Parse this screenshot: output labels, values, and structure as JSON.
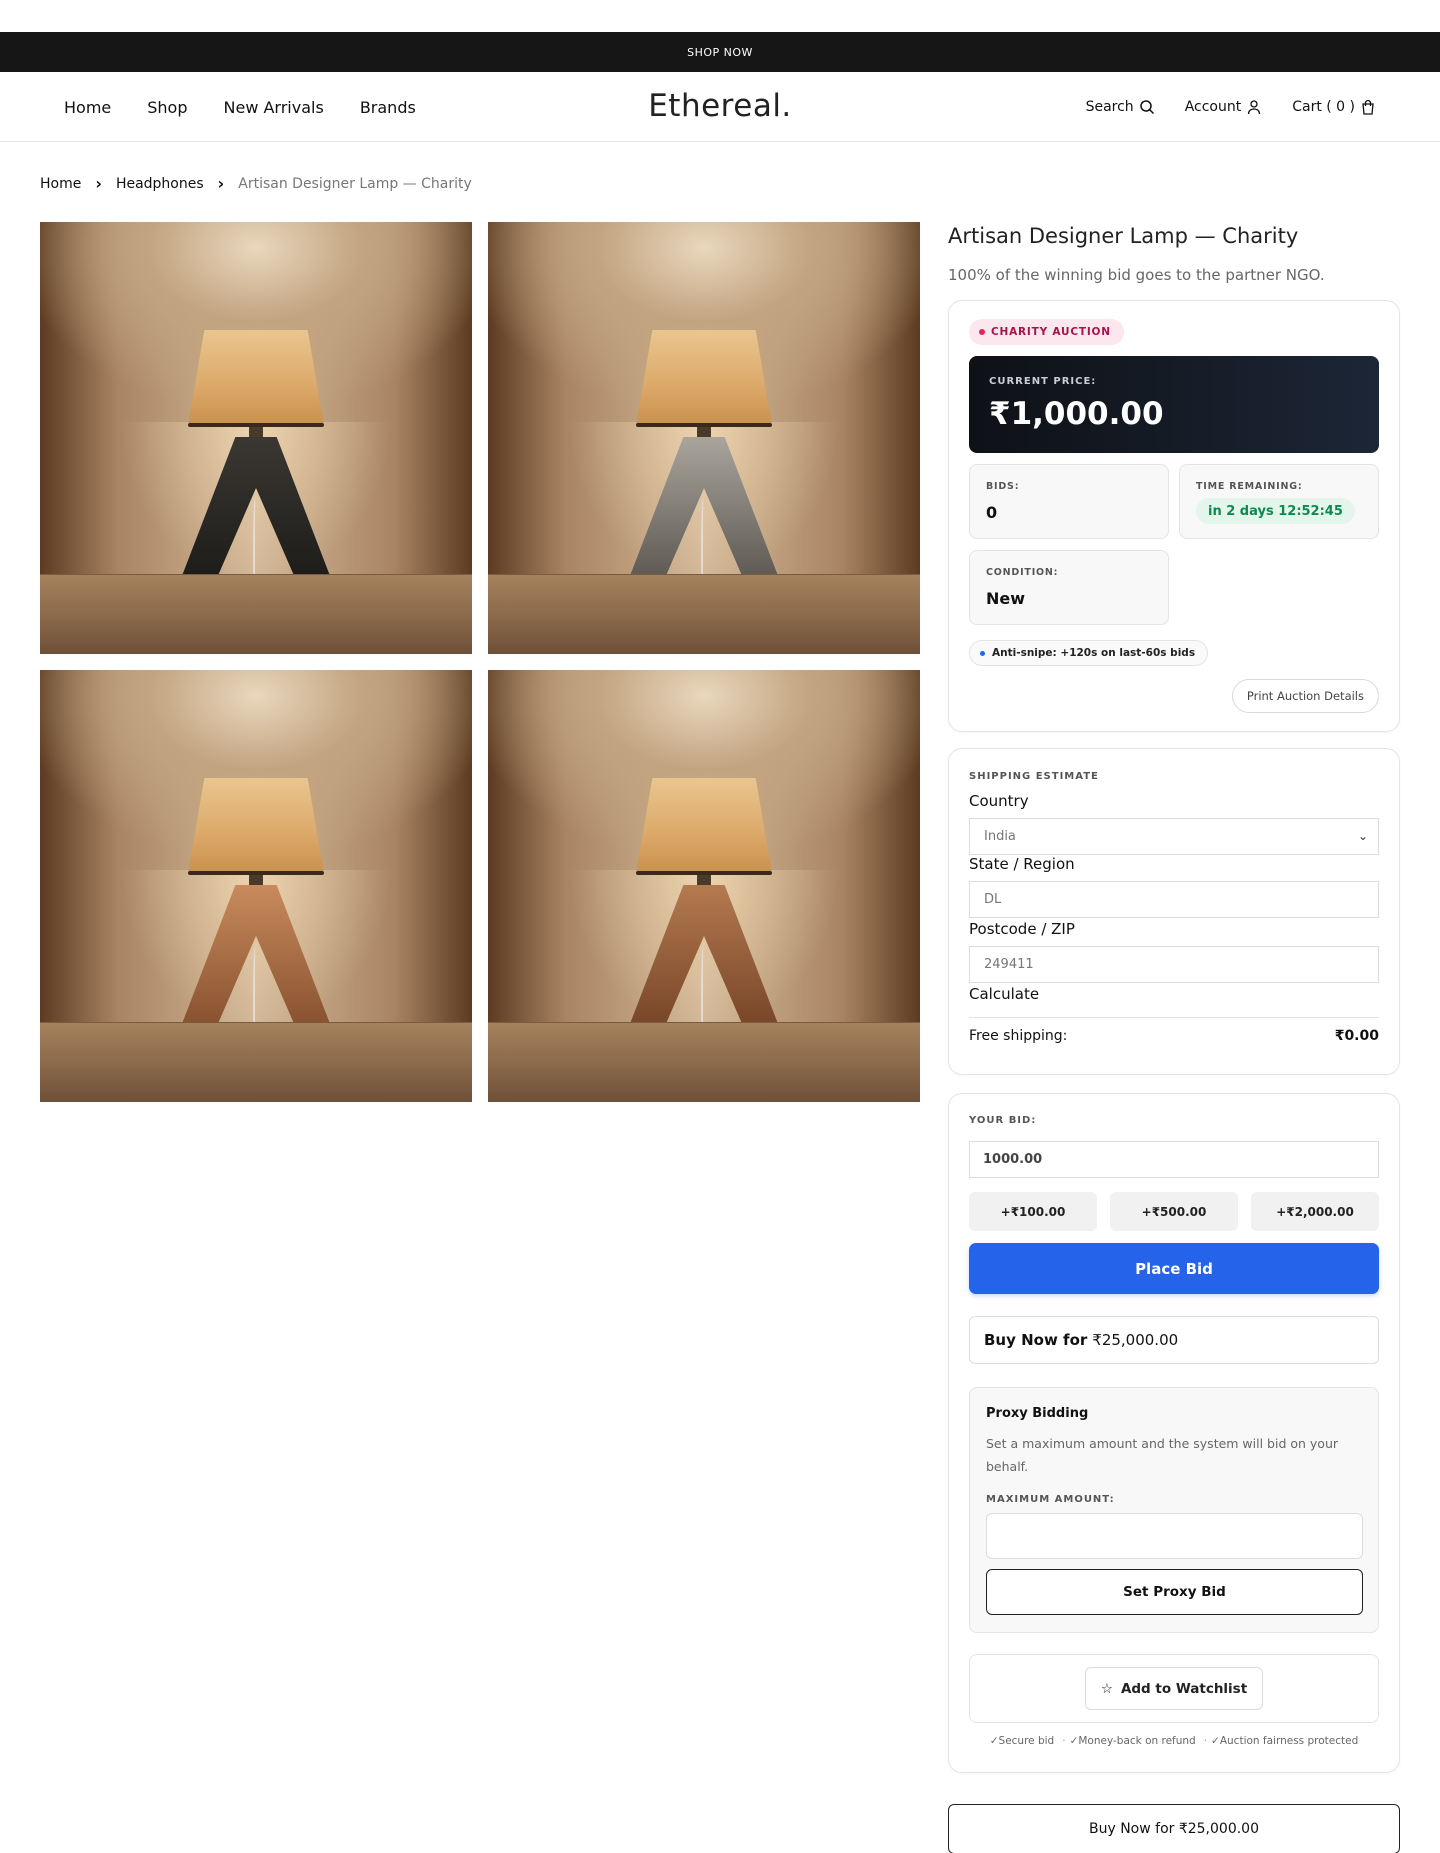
{
  "announcement": "SHOP NOW",
  "nav": [
    "Home",
    "Shop",
    "New Arrivals",
    "Brands"
  ],
  "logo": "Ethereal.",
  "header_right": {
    "search": "Search",
    "account": "Account",
    "cart": "Cart ( 0 )",
    "icons": [
      "search-icon",
      "user-icon",
      "bag-icon"
    ]
  },
  "breadcrumb": [
    "Home",
    "Headphones",
    "Artisan Designer Lamp — Charity"
  ],
  "gallery": {
    "images": [
      {
        "subject": "lamp",
        "base_color": "#171614"
      },
      {
        "subject": "lamp",
        "base_color": "#4e4a44"
      },
      {
        "subject": "lamp",
        "base_color": "#7a4526"
      },
      {
        "subject": "lamp",
        "base_color": "#6b3b20"
      }
    ]
  },
  "product": {
    "title": "Artisan Designer Lamp — Charity",
    "subtitle": "100% of the winning bid goes to the partner NGO."
  },
  "auction": {
    "badge": "CHARITY AUCTION",
    "current_price_label": "CURRENT PRICE:",
    "current_price": "₹1,000.00",
    "bids_label": "BIDS:",
    "bids": "0",
    "time_label": "TIME REMAINING:",
    "time_remaining": "in 2 days 12:52:45",
    "condition_label": "CONDITION:",
    "condition": "New",
    "anti_snipe": "Anti-snipe: +120s on last-60s bids",
    "print_button": "Print Auction Details"
  },
  "shipping": {
    "section_label": "SHIPPING ESTIMATE",
    "country_label": "Country",
    "country_value": "India",
    "state_label": "State / Region",
    "state_placeholder": "DL",
    "postcode_label": "Postcode / ZIP",
    "postcode_placeholder": "249411",
    "calculate": "Calculate",
    "result_label": "Free shipping:",
    "result_value": "₹0.00"
  },
  "bid": {
    "label": "YOUR BID:",
    "value": "1000.00",
    "increments": [
      "+₹100.00",
      "+₹500.00",
      "+₹2,000.00"
    ],
    "place_button": "Place Bid",
    "buy_now_prefix": "Buy Now for",
    "buy_now_price": "₹25,000.00"
  },
  "proxy": {
    "title": "Proxy Bidding",
    "description": "Set a maximum amount and the system will bid on your behalf.",
    "max_label": "MAXIMUM AMOUNT:",
    "set_button": "Set Proxy Bid"
  },
  "watchlist": {
    "icon": "☆",
    "label": "Add to Watchlist"
  },
  "trust": [
    "✓Secure bid",
    "✓Money-back on refund",
    "✓Auction fairness protected"
  ],
  "bottom_buy_now": "Buy Now for ₹25,000.00",
  "colors": {
    "primary_blue": "#2563eb",
    "badge_pink": "#fde7ef",
    "badge_text": "#a3154a",
    "timer_green": "#0d8a4f",
    "price_dark": "#0e1116"
  }
}
